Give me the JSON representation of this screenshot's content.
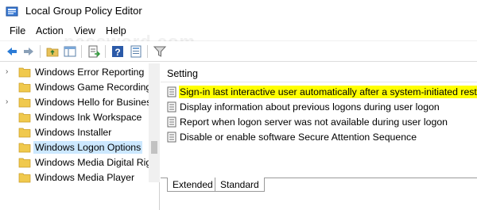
{
  "window": {
    "title": "Local Group Policy Editor"
  },
  "watermark": "password.com",
  "menu": [
    "File",
    "Action",
    "View",
    "Help"
  ],
  "toolbar": {
    "buttons": [
      "back-icon",
      "forward-icon",
      "up-folder-icon",
      "show-hide-tree-icon",
      "export-list-icon",
      "help-icon",
      "properties-icon",
      "filter-icon"
    ]
  },
  "tree": {
    "items": [
      {
        "label": "Windows Error Reporting",
        "selected": false
      },
      {
        "label": "Windows Game Recording",
        "selected": false
      },
      {
        "label": "Windows Hello for Business",
        "selected": false
      },
      {
        "label": "Windows Ink Workspace",
        "selected": false
      },
      {
        "label": "Windows Installer",
        "selected": false
      },
      {
        "label": "Windows Logon Options",
        "selected": true
      },
      {
        "label": "Windows Media Digital Rig",
        "selected": false
      },
      {
        "label": "Windows Media Player",
        "selected": false
      }
    ]
  },
  "list": {
    "column_header": "Setting",
    "rows": [
      {
        "label": "Sign-in last interactive user automatically after a system-initiated restart",
        "highlight": true
      },
      {
        "label": "Display information about previous logons during user logon",
        "highlight": false
      },
      {
        "label": "Report when logon server was not available during user logon",
        "highlight": false
      },
      {
        "label": "Disable or enable software Secure Attention Sequence",
        "highlight": false
      }
    ]
  },
  "tabs": [
    {
      "label": "Extended",
      "active": false
    },
    {
      "label": "Standard",
      "active": true
    }
  ],
  "colors": {
    "highlight": "#ffff00",
    "selection": "#cce8ff"
  }
}
